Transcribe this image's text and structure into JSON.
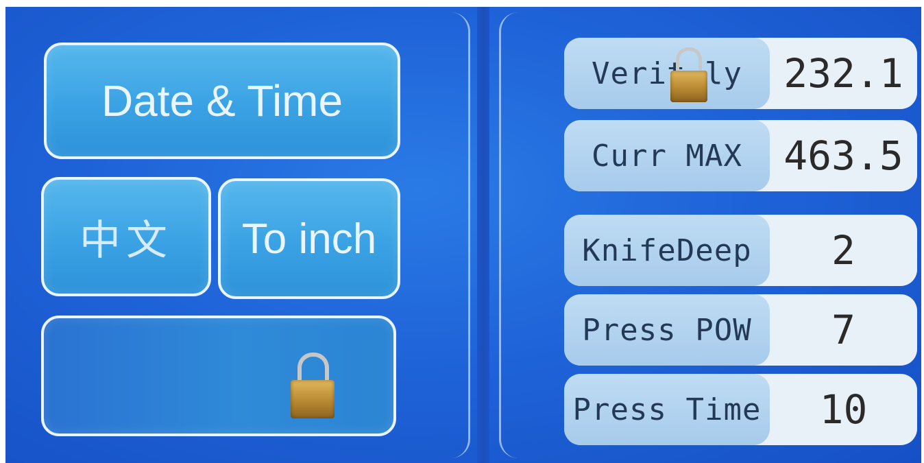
{
  "left_panel": {
    "date_time_label": "Date & Time",
    "language_label": "中文",
    "unit_label": "To inch",
    "lock_icon": "padlock-icon"
  },
  "parameters": [
    {
      "label": "Verit ly",
      "value": "232.1",
      "icon": "padlock-icon"
    },
    {
      "label": "Curr MAX",
      "value": "463.5"
    },
    {
      "label": "KnifeDeep",
      "value": "2"
    },
    {
      "label": "Press POW",
      "value": "7"
    },
    {
      "label": "Press Time",
      "value": "10"
    }
  ],
  "colors": {
    "background": "#1f63d8",
    "button": "#3aa2e4",
    "label_bg": "#b3d3ef",
    "value_bg": "#e8f0f8",
    "lock_gold": "#c89a42"
  }
}
